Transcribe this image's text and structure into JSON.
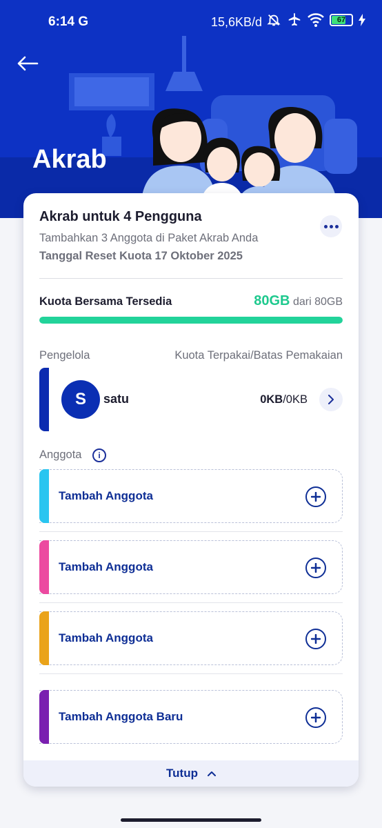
{
  "status_bar": {
    "time": "6:14",
    "network_type": "G",
    "data_speed": "15,6KB/d",
    "battery_level": "67"
  },
  "header": {
    "title": "Akrab"
  },
  "card": {
    "title": "Akrab untuk 4 Pengguna",
    "subtitle": "Tambahkan 3 Anggota di Paket Akrab Anda",
    "reset_date": "Tanggal Reset Kuota 17 Oktober 2025",
    "shared_quota": {
      "label": "Kuota Bersama Tersedia",
      "available": "80GB",
      "total_text": "dari 80GB",
      "fraction_available": 1.0
    },
    "manager_section": {
      "label": "Pengelola",
      "usage_header": "Kuota Terpakai/Batas Pemakaian",
      "manager": {
        "initial": "S",
        "name": "satu",
        "used": "0KB",
        "limit": "/0KB"
      }
    },
    "member_section": {
      "label": "Anggota",
      "slots": [
        {
          "label": "Tambah Anggota",
          "accent": "#29c5f0"
        },
        {
          "label": "Tambah Anggota",
          "accent": "#ec4aa0"
        },
        {
          "label": "Tambah Anggota",
          "accent": "#eaa31a"
        },
        {
          "label": "Tambah Anggota Baru",
          "accent": "#7a1fb0"
        }
      ]
    },
    "close_label": "Tutup"
  },
  "colors": {
    "brand_blue": "#0d32c4",
    "accent_green": "#22d39a",
    "link_blue": "#0e2e95"
  }
}
